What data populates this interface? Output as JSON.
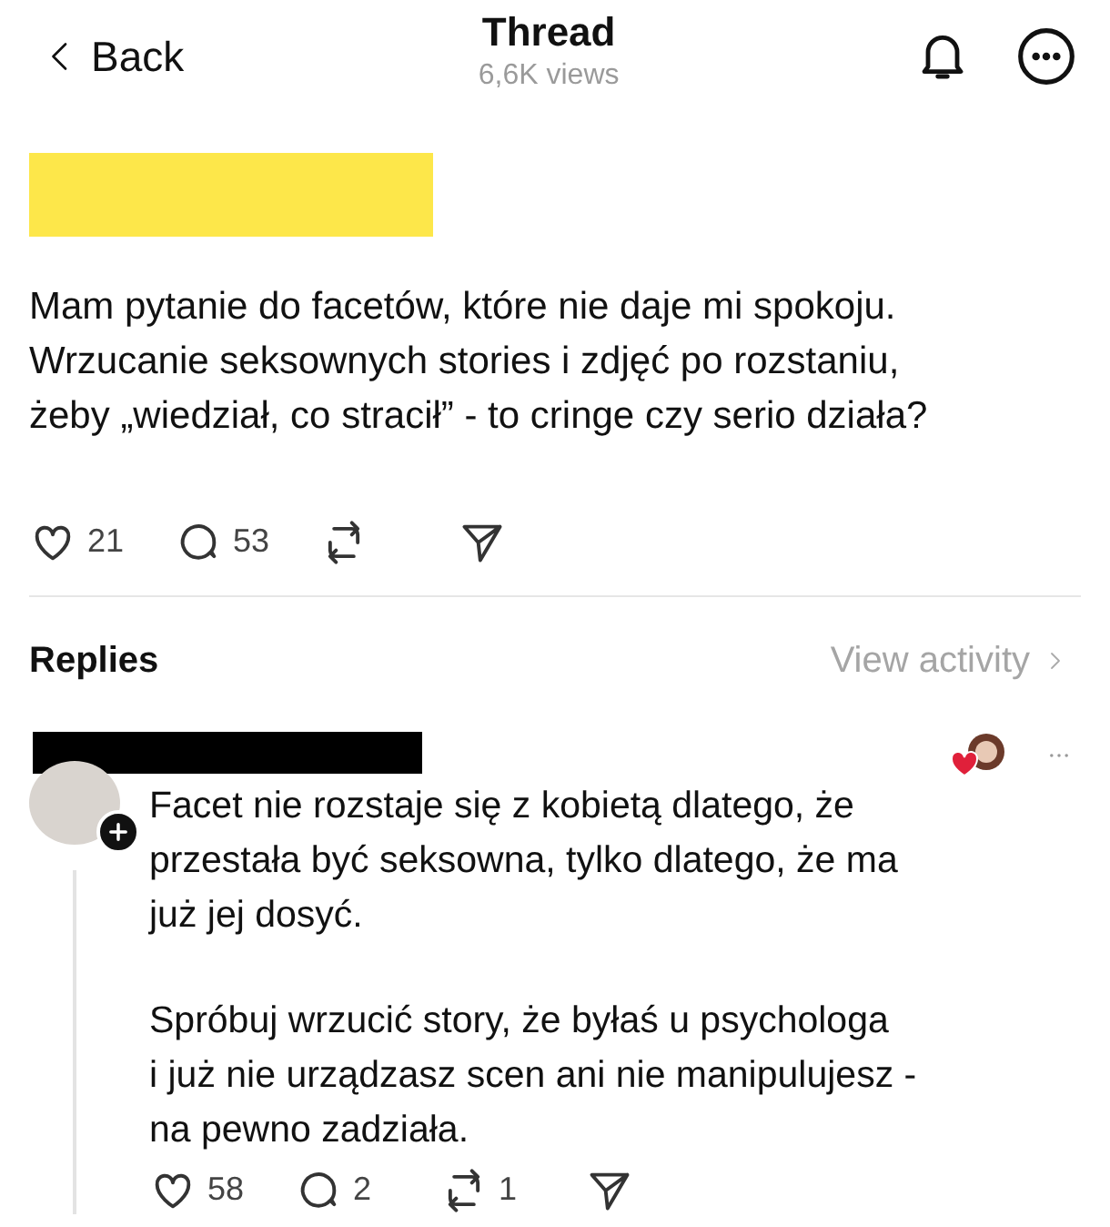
{
  "header": {
    "back": "Back",
    "title": "Thread",
    "views": "6,6K views"
  },
  "post": {
    "author_redacted": true,
    "lines": [
      "Mam pytanie do facetów, które nie daje mi spokoju.",
      "Wrzucanie seksownych stories i zdjęć po rozstaniu,",
      "żeby „wiedział, co stracił” - to cringe czy serio działa?"
    ],
    "actions": [
      {
        "kind": "like",
        "count": "21"
      },
      {
        "kind": "comment",
        "count": "53"
      },
      {
        "kind": "repost"
      },
      {
        "kind": "share"
      }
    ]
  },
  "replies_header": {
    "title": "Replies",
    "link": "View activity"
  },
  "reply": {
    "author_redacted": true,
    "liked_by_author": true,
    "paragraphs": [
      [
        "Facet nie rozstaje się z kobietą dlatego, że",
        "przestała być seksowna, tylko dlatego, że ma",
        "już jej dosyć."
      ],
      [
        "Spróbuj wrzucić story, że byłaś u psychologa",
        "i już nie urządzasz scen ani nie manipulujesz -",
        "na pewno zadziała."
      ]
    ],
    "actions": [
      {
        "kind": "like",
        "count": "58"
      },
      {
        "kind": "comment",
        "count": "2"
      },
      {
        "kind": "repost",
        "count": "1"
      },
      {
        "kind": "share"
      }
    ]
  }
}
